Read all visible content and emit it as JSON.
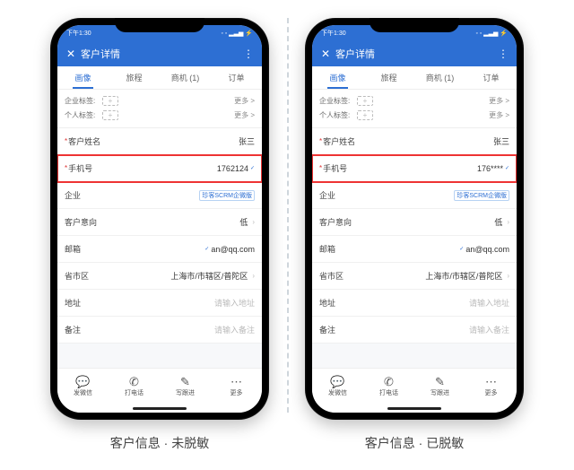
{
  "captions": {
    "left": "客户信息 · 未脱敏",
    "right": "客户信息 · 已脱敏"
  },
  "status": {
    "time": "下午1:30"
  },
  "header": {
    "close": "✕",
    "title": "客户详情",
    "more": "⋮"
  },
  "tabs": [
    "画像",
    "旅程",
    "商机 (1)",
    "订单"
  ],
  "tags": {
    "corp_label": "企业标签:",
    "pers_label": "个人标签:",
    "add": "+",
    "more": "更多 >"
  },
  "rows": {
    "name": {
      "k": "客户姓名",
      "v": "张三",
      "req": "*"
    },
    "phone_left": {
      "k": "手机号",
      "v": "1762124",
      "req": "*"
    },
    "phone_right": {
      "k": "手机号",
      "v": "176****",
      "req": "*"
    },
    "company": {
      "k": "企业",
      "badge": "珍客SCRM企微版"
    },
    "intent": {
      "k": "客户意向",
      "v": "低"
    },
    "email": {
      "k": "邮箱",
      "v": "an@qq.com"
    },
    "region": {
      "k": "省市区",
      "v": "上海市/市辖区/普陀区"
    },
    "address": {
      "k": "地址",
      "ph": "请输入地址"
    },
    "remark": {
      "k": "备注",
      "ph": "请输入备注"
    }
  },
  "bottom": {
    "wechat": "发微信",
    "call": "打电话",
    "follow": "写跟进",
    "more": "更多"
  },
  "icons": {
    "wechat": "💬",
    "call": "✆",
    "follow": "✎",
    "more": "⋯"
  },
  "tinycode": "✓"
}
